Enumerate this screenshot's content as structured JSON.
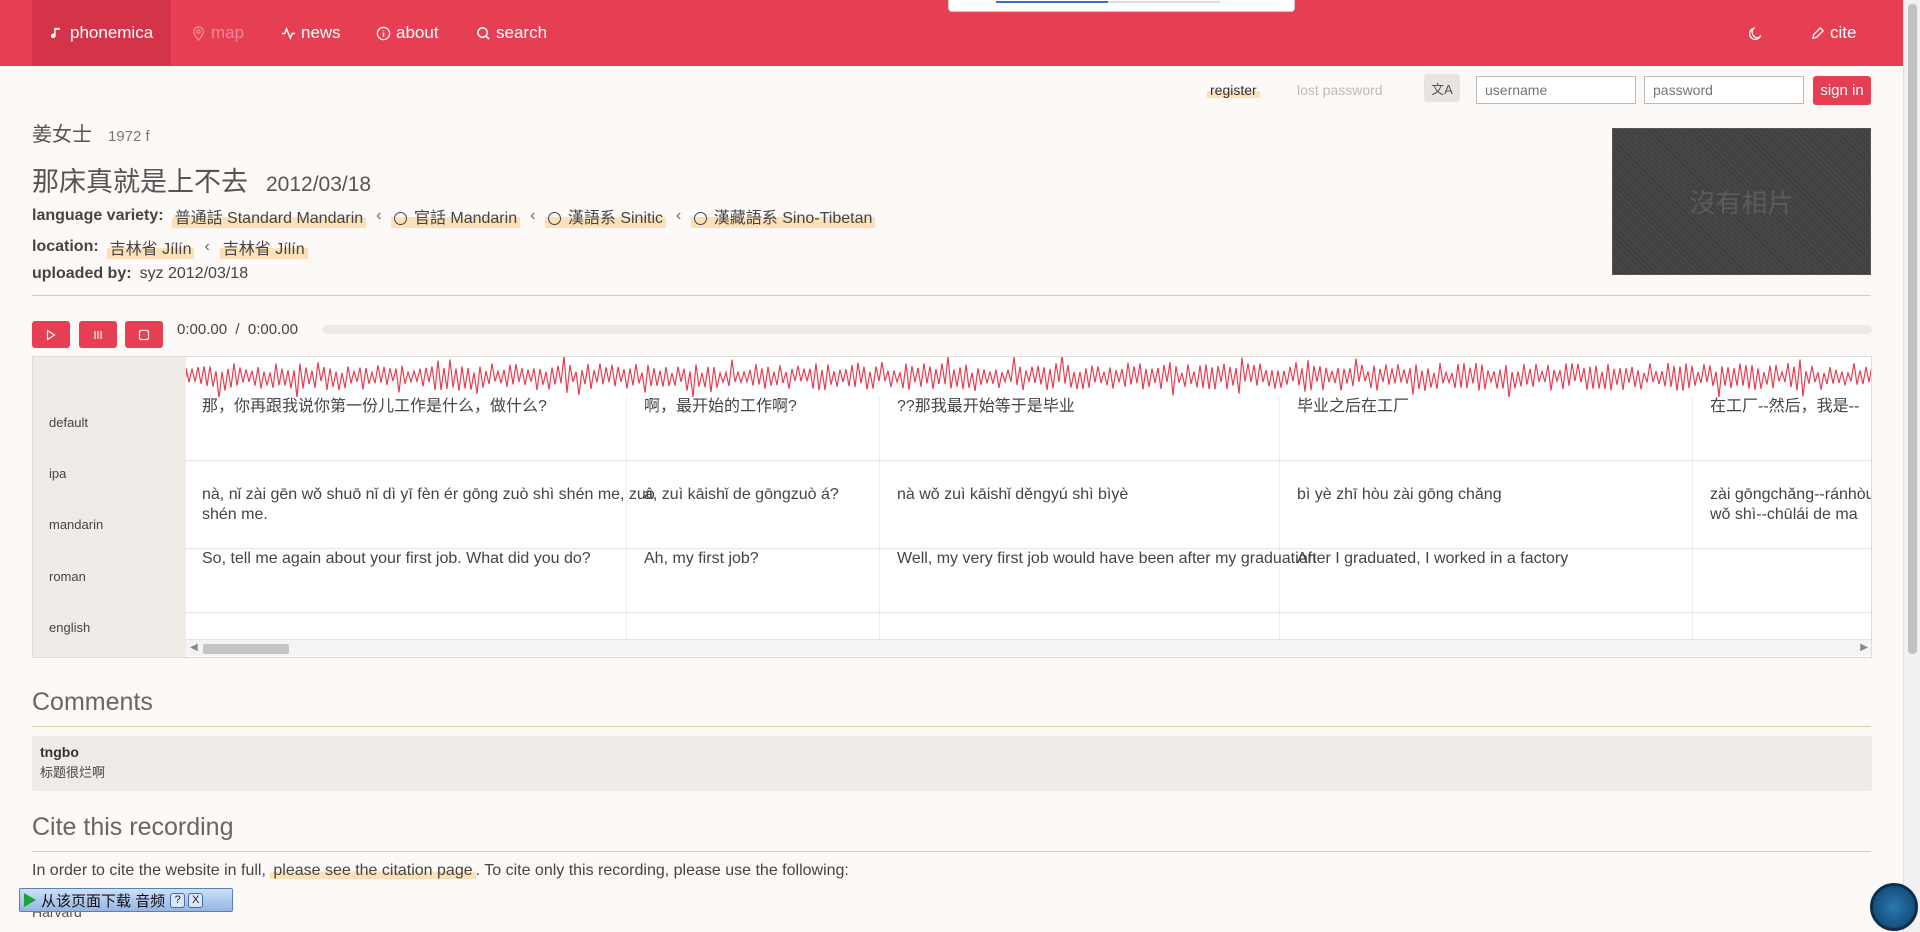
{
  "nav": {
    "brand": "phonemica",
    "map": "map",
    "news": "news",
    "about": "about",
    "search": "search",
    "cite": "cite"
  },
  "auth": {
    "register": "register",
    "lost_password": "lost password",
    "username_placeholder": "username",
    "password_placeholder": "password",
    "sign_in": "sign in"
  },
  "speaker": {
    "name": "姜女士",
    "info": "1972 f"
  },
  "recording": {
    "title": "那床真就是上不去",
    "date": "2012/03/18",
    "photo_text": "沒有相片"
  },
  "language_variety": {
    "label": "language variety:",
    "items": [
      "普通話 Standard Mandarin",
      "官話 Mandarin",
      "漢語系 Sinitic",
      "漢藏語系 Sino-Tibetan"
    ]
  },
  "location": {
    "label": "location:",
    "items": [
      "吉林省 Jílín",
      "吉林省 Jílín"
    ]
  },
  "uploaded": {
    "label": "uploaded by:",
    "value": "syz 2012/03/18"
  },
  "player": {
    "current": "0:00.00",
    "separator": "/",
    "total": "0:00.00"
  },
  "tiers": [
    "default",
    "ipa",
    "mandarin",
    "roman",
    "english"
  ],
  "segments": [
    {
      "default": "那，你再跟我说你第一份儿工作是什么，做什么?",
      "roman": "nà, nǐ zài gēn wǒ shuō nǐ dì yī fèn ér gōng zuò shì shén me, zuò shén me.",
      "english": "So, tell me again about your first job. What did you do?"
    },
    {
      "default": "啊，最开始的工作啊?",
      "roman": "á, zuì kāishǐ de gōngzuò á?",
      "english": "Ah, my first job?"
    },
    {
      "default": "??那我最开始等于是毕业",
      "roman": "nà wǒ zuì kāishǐ děngyú shì bìyè",
      "english": "Well, my very first job would have been after my graduation"
    },
    {
      "default": "毕业之后在工厂",
      "roman": "bì yè zhī hòu zài gōng chǎng",
      "english": "After I graduated, I worked in a factory"
    },
    {
      "default": "在工厂--然后，我是--",
      "roman": "zài gōngchǎng--ránhòu, wǒ shì--chūlái de ma",
      "english": ""
    }
  ],
  "comments": {
    "heading": "Comments",
    "items": [
      {
        "author": "tngbo",
        "text": "标题很烂啊"
      }
    ]
  },
  "cite": {
    "heading": "Cite this recording",
    "text_before": "In order to cite the website in full,",
    "link": "please see the citation page",
    "text_after": ". To cite only this recording, please use the following:",
    "style": "Harvard"
  },
  "download_widget": {
    "label": "从该页面下载 音频",
    "help": "?",
    "close": "X"
  },
  "colors": {
    "accent": "#e63e53",
    "highlight": "#fbe0b8",
    "panel": "#efebe7"
  }
}
